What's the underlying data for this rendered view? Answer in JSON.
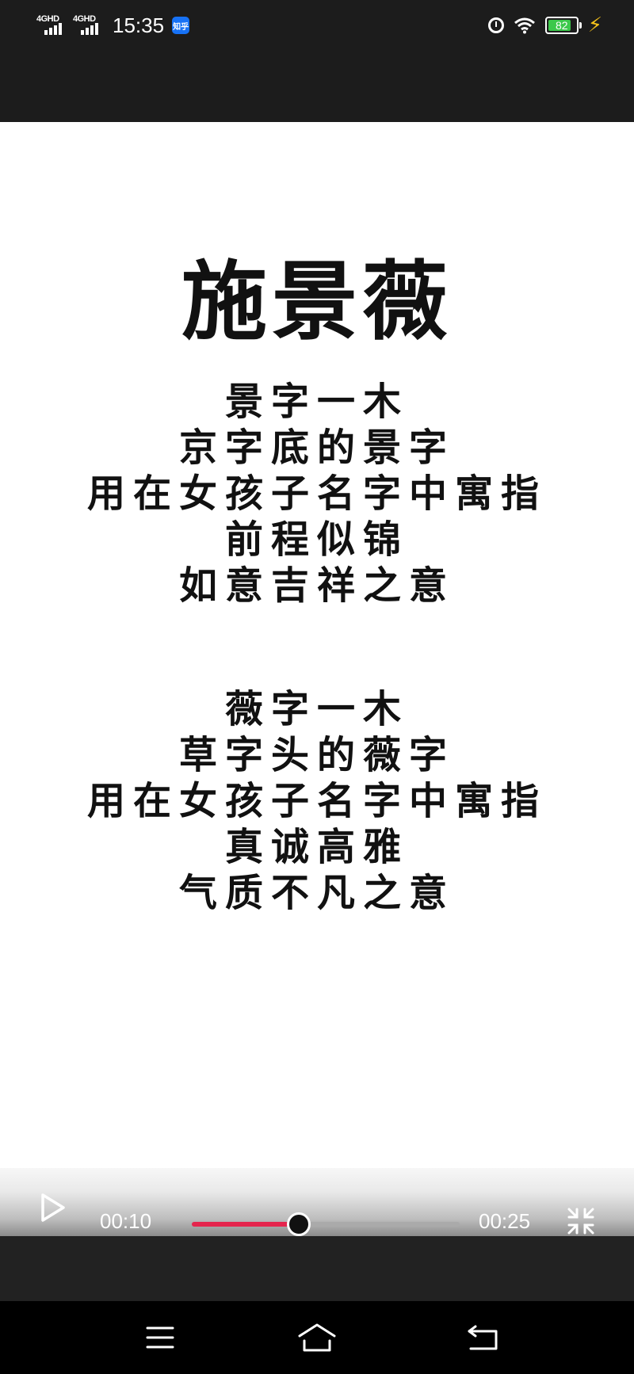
{
  "status_bar": {
    "network_1": "4GHD",
    "network_2": "4GHD",
    "time": "15:35",
    "app_badge": "知乎",
    "battery_level": "82",
    "icons": [
      "signal-icon",
      "app-badge-icon",
      "alarm-icon",
      "wifi-icon",
      "battery-icon",
      "charging-icon"
    ]
  },
  "content": {
    "title": "施景薇",
    "stanza_1": [
      "景字一木",
      "京字底的景字",
      "用在女孩子名字中寓指",
      "前程似锦",
      "如意吉祥之意"
    ],
    "stanza_2": [
      "薇字一木",
      "草字头的薇字",
      "用在女孩子名字中寓指",
      "真诚高雅",
      "气质不凡之意"
    ]
  },
  "player": {
    "current_time": "00:10",
    "total_time": "00:25",
    "progress": 0.4,
    "accent_color": "#e5254d",
    "icons": [
      "play-icon",
      "exit-fullscreen-icon"
    ]
  },
  "nav_bar": {
    "icons": [
      "menu-icon",
      "home-icon",
      "back-icon"
    ]
  }
}
